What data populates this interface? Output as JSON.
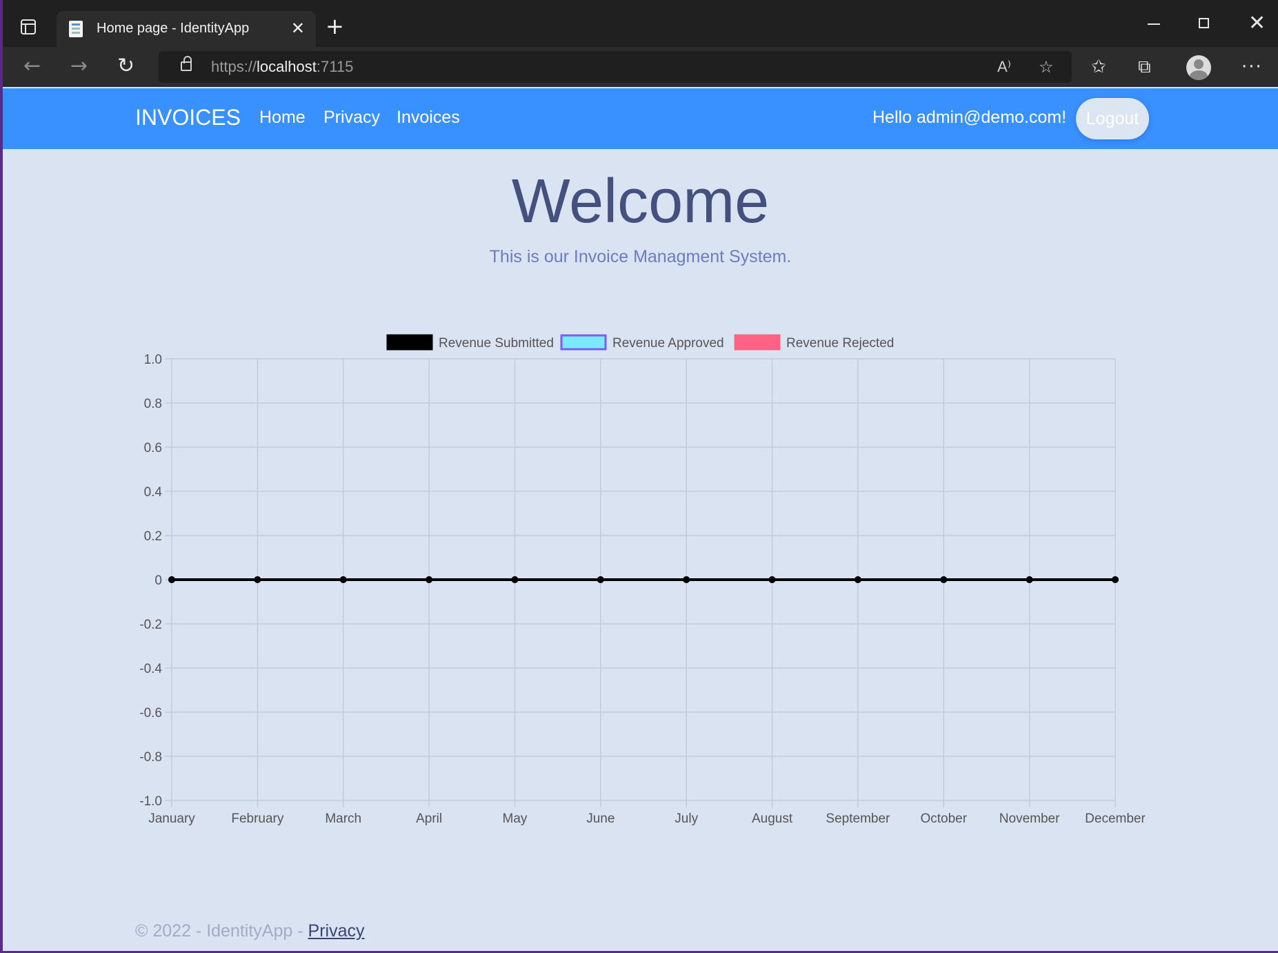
{
  "browser": {
    "tab_title": "Home page - IdentityApp",
    "new_tab_symbol": "+",
    "url_prefix": "https://",
    "url_host": "localhost",
    "url_port": ":7115"
  },
  "navbar": {
    "brand": "INVOICES",
    "links": [
      "Home",
      "Privacy",
      "Invoices"
    ],
    "greeting": "Hello admin@demo.com!",
    "logout_label": "Logout",
    "color": "#3990ff"
  },
  "main": {
    "title": "Welcome",
    "subtitle": "This is our Invoice Managment System."
  },
  "chart_data": {
    "type": "line",
    "categories": [
      "January",
      "February",
      "March",
      "April",
      "May",
      "June",
      "July",
      "August",
      "September",
      "October",
      "November",
      "December"
    ],
    "ylim": [
      -1.0,
      1.0
    ],
    "yticks": [
      "1.0",
      "0.8",
      "0.6",
      "0.4",
      "0.2",
      "0",
      "-0.2",
      "-0.4",
      "-0.6",
      "-0.8",
      "-1.0"
    ],
    "ytick_values": [
      1.0,
      0.8,
      0.6,
      0.4,
      0.2,
      0,
      -0.2,
      -0.4,
      -0.6,
      -0.8,
      -1.0
    ],
    "legend_position": "top",
    "grid": true,
    "series": [
      {
        "name": "Revenue Submitted",
        "color": "#000000",
        "border": "#000000",
        "values": [
          0,
          0,
          0,
          0,
          0,
          0,
          0,
          0,
          0,
          0,
          0,
          0
        ]
      },
      {
        "name": "Revenue Approved",
        "color": "#7de9ff",
        "border": "#7b5cff",
        "values": [
          0,
          0,
          0,
          0,
          0,
          0,
          0,
          0,
          0,
          0,
          0,
          0
        ]
      },
      {
        "name": "Revenue Rejected",
        "color": "#ff6384",
        "border": "#ff6384",
        "values": [
          0,
          0,
          0,
          0,
          0,
          0,
          0,
          0,
          0,
          0,
          0,
          0
        ]
      }
    ]
  },
  "footer": {
    "text": "© 2022 - IdentityApp - ",
    "privacy_link": "Privacy"
  }
}
